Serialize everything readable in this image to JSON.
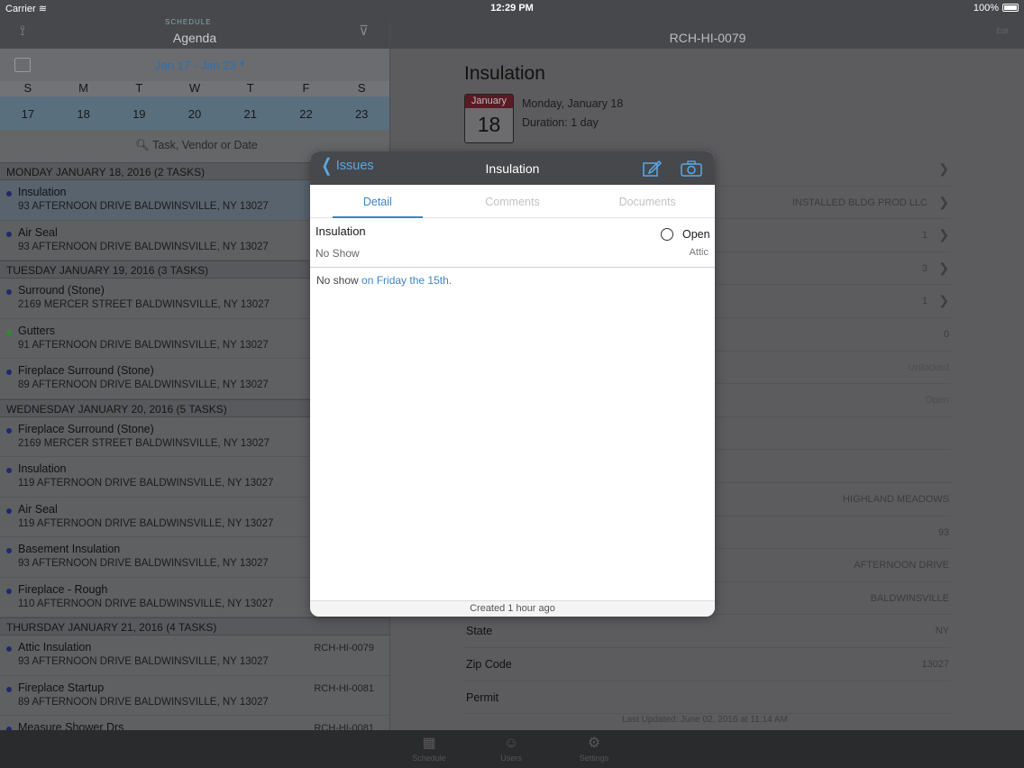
{
  "status_bar": {
    "carrier": "Carrier",
    "time": "12:29 PM",
    "battery": "100%"
  },
  "left": {
    "logo": "SCHEDULE",
    "title": "Agenda",
    "week_range": "Jan 17 - Jan 23",
    "weekdays": [
      "S",
      "M",
      "T",
      "W",
      "T",
      "F",
      "S"
    ],
    "dates": [
      "17",
      "18",
      "19",
      "20",
      "21",
      "22",
      "23"
    ],
    "search_placeholder": "Task, Vendor or Date",
    "sections": [
      {
        "header": "MONDAY JANUARY 18, 2016 (2 TASKS)",
        "tasks": [
          {
            "name": "Insulation",
            "address": "93 AFTERNOON DRIVE BALDWINSVILLE, NY 13027",
            "dot": "blue",
            "selected": true
          },
          {
            "name": "Air Seal",
            "address": "93 AFTERNOON DRIVE BALDWINSVILLE, NY 13027",
            "dot": "blue"
          }
        ]
      },
      {
        "header": "TUESDAY JANUARY 19, 2016 (3 TASKS)",
        "tasks": [
          {
            "name": "Surround (Stone)",
            "address": "2169 MERCER STREET BALDWINSVILLE, NY 13027",
            "dot": "blue"
          },
          {
            "name": "Gutters",
            "address": "91 AFTERNOON DRIVE BALDWINSVILLE, NY 13027",
            "dot": "green"
          },
          {
            "name": "Fireplace Surround (Stone)",
            "address": "89 AFTERNOON DRIVE BALDWINSVILLE, NY 13027",
            "dot": "blue"
          }
        ]
      },
      {
        "header": "WEDNESDAY JANUARY 20, 2016 (5 TASKS)",
        "tasks": [
          {
            "name": "Fireplace Surround (Stone)",
            "address": "2169 MERCER STREET BALDWINSVILLE, NY 13027",
            "dot": "blue"
          },
          {
            "name": "Insulation",
            "address": "119 AFTERNOON DRIVE BALDWINSVILLE, NY 13027",
            "dot": "blue"
          },
          {
            "name": "Air Seal",
            "address": "119 AFTERNOON DRIVE BALDWINSVILLE, NY 13027",
            "dot": "blue"
          },
          {
            "name": "Basement Insulation",
            "address": "93 AFTERNOON DRIVE BALDWINSVILLE, NY 13027",
            "dot": "blue"
          },
          {
            "name": "Fireplace - Rough",
            "address": "110 AFTERNOON DRIVE BALDWINSVILLE, NY 13027",
            "dot": "blue"
          }
        ]
      },
      {
        "header": "THURSDAY JANUARY 21, 2016 (4 TASKS)",
        "tasks": [
          {
            "name": "Attic Insulation",
            "address": "93 AFTERNOON DRIVE BALDWINSVILLE, NY 13027",
            "code": "RCH-HI-0079",
            "dot": "blue"
          },
          {
            "name": "Fireplace Startup",
            "address": "89 AFTERNOON DRIVE BALDWINSVILLE, NY 13027",
            "code": "RCH-HI-0081",
            "dot": "blue"
          },
          {
            "name": "Measure Shower Drs",
            "address": "",
            "code": "RCH-HI-0081",
            "dot": "blue"
          }
        ]
      }
    ]
  },
  "right": {
    "nav_title": "RCH-HI-0079",
    "nav_edit": "Edit",
    "title": "Insulation",
    "calendar_month": "January",
    "calendar_day": "18",
    "date_text": "Monday, January 18",
    "duration_text": "Duration: 1 day",
    "fields": [
      {
        "label": "",
        "value": "",
        "chevron": true
      },
      {
        "label": "",
        "value": "INSTALLED BLDG PROD LLC",
        "chevron": true
      },
      {
        "label": "",
        "value": "1",
        "chevron": true
      },
      {
        "label": "",
        "value": "3",
        "chevron": true
      },
      {
        "label": "",
        "value": "1",
        "chevron": true
      },
      {
        "label": "",
        "value": "0",
        "chevron": false
      },
      {
        "label": "",
        "value": "Unlocked",
        "chevron": false,
        "dim": true
      },
      {
        "label": "",
        "value": "Open",
        "chevron": false,
        "dim": true
      },
      {
        "label": "",
        "value": "",
        "chevron": false
      },
      {
        "label": "",
        "value": "",
        "chevron": false
      },
      {
        "label": "",
        "value": "HIGHLAND MEADOWS",
        "chevron": false
      },
      {
        "label": "",
        "value": "93",
        "chevron": false
      },
      {
        "label": "",
        "value": "AFTERNOON DRIVE",
        "chevron": false
      },
      {
        "label": "",
        "value": "BALDWINSVILLE",
        "chevron": false
      },
      {
        "label": "State",
        "value": "NY",
        "chevron": false
      },
      {
        "label": "Zip Code",
        "value": "13027",
        "chevron": false
      },
      {
        "label": "Permit",
        "value": "",
        "chevron": false
      }
    ],
    "last_updated": "Last Updated: June 02, 2016 at 11:14 AM"
  },
  "tabbar": {
    "tabs": [
      "Schedule",
      "Users",
      "Settings"
    ]
  },
  "modal": {
    "back_label": "Issues",
    "title": "Insulation",
    "tabs": [
      "Detail",
      "Comments",
      "Documents"
    ],
    "active_tab": "Detail",
    "issue_name": "Insulation",
    "issue_type": "No Show",
    "status": "Open",
    "location": "Attic",
    "note_text": "No show ",
    "note_link": "on Friday the 15th.",
    "footer": "Created 1 hour ago"
  },
  "colors": {
    "accent": "#3d82bf",
    "link": "#5aa9e6",
    "calendar_month_bg": "#5a1a24",
    "dot_blue": "#1f2a6c",
    "dot_green": "#2f8a34"
  }
}
